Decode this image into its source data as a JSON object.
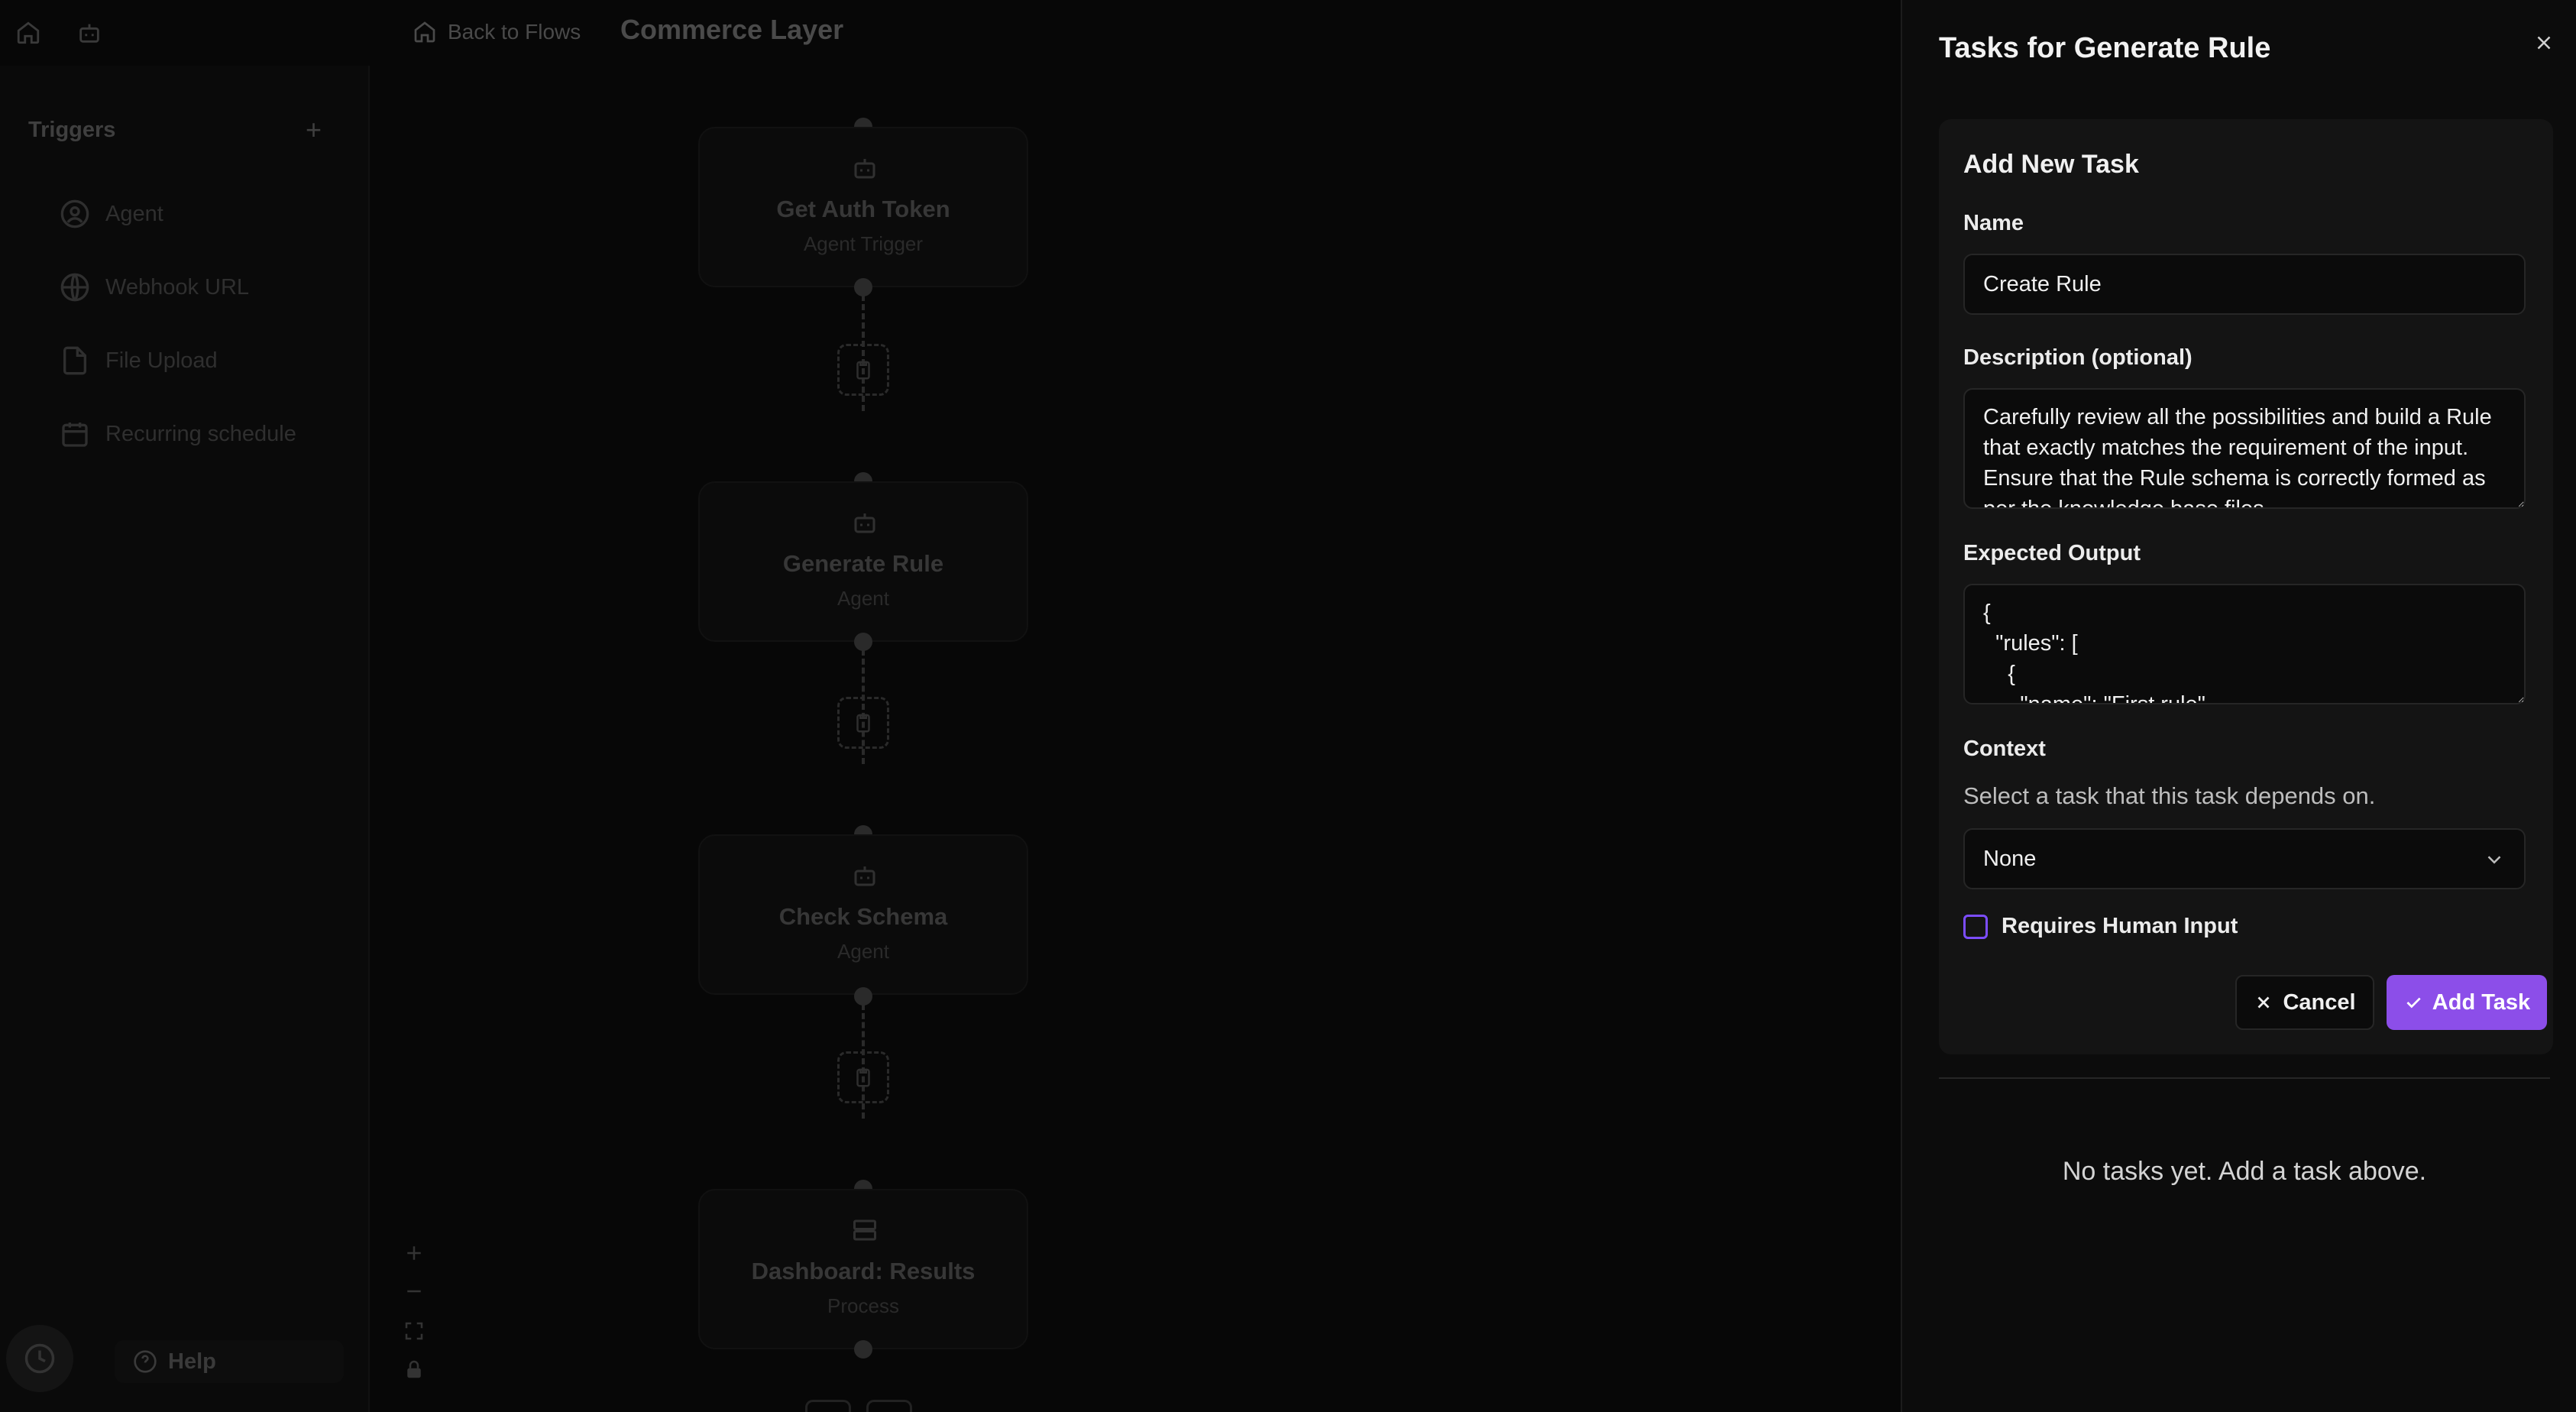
{
  "topbar": {
    "back_label": "Back to Flows",
    "flow_title": "Commerce Layer"
  },
  "sidebar": {
    "triggers_title": "Triggers",
    "add_symbol": "+",
    "items": [
      {
        "label": "Agent",
        "icon": "user-circle-icon"
      },
      {
        "label": "Webhook URL",
        "icon": "globe-icon"
      },
      {
        "label": "File Upload",
        "icon": "file-icon"
      },
      {
        "label": "Recurring schedule",
        "icon": "calendar-icon"
      }
    ],
    "help_label": "Help"
  },
  "canvas": {
    "nodes": [
      {
        "title": "Get Auth Token",
        "subtitle": "Agent Trigger",
        "icon": "bot-icon"
      },
      {
        "title": "Generate Rule",
        "subtitle": "Agent",
        "icon": "bot-icon"
      },
      {
        "title": "Check Schema",
        "subtitle": "Agent",
        "icon": "bot-icon"
      },
      {
        "title": "Dashboard: Results",
        "subtitle": "Process",
        "icon": "server-icon"
      }
    ]
  },
  "panel": {
    "title": "Tasks for Generate Rule",
    "form_title": "Add New Task",
    "name_label": "Name",
    "name_value": "Create Rule",
    "description_label": "Description (optional)",
    "description_value": "Carefully review all the possibilities and build a Rule that exactly matches the requirement of the input. Ensure that the Rule schema is correctly formed as per the knowledge base files.",
    "expected_label": "Expected Output",
    "expected_value": "{\n  \"rules\": [\n    {\n      \"name\": \"First rule\",",
    "context_label": "Context",
    "context_helper": "Select a task that this task depends on.",
    "context_selected": "None",
    "human_input_label": "Requires Human Input",
    "cancel_label": "Cancel",
    "add_label": "Add Task",
    "empty_message": "No tasks yet. Add a task above."
  },
  "colors": {
    "accent": "#8c4ee9",
    "checkbox_border": "#7c4dff",
    "panel_bg": "#0c0c0c"
  }
}
